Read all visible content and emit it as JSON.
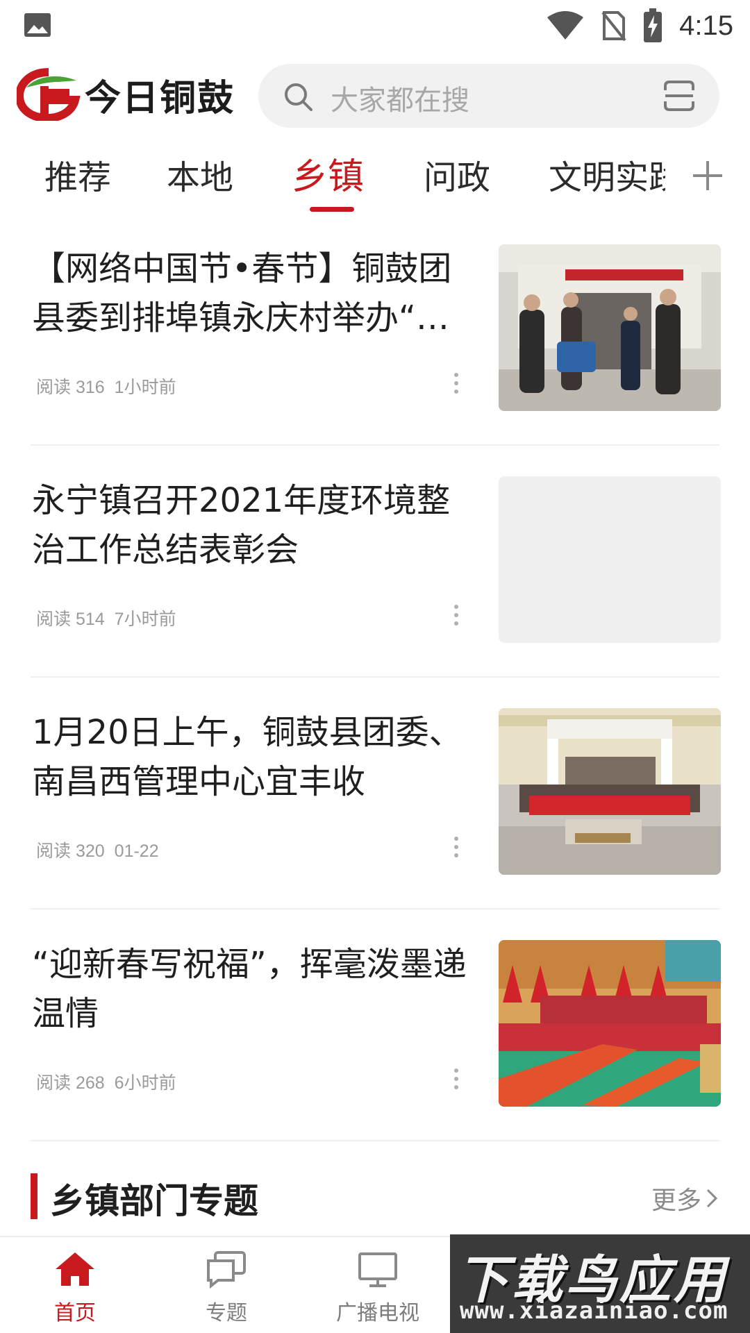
{
  "status_bar": {
    "time": "4:15",
    "icons": [
      "image-icon",
      "wifi-icon",
      "no-sim-icon",
      "battery-charging-icon"
    ]
  },
  "header": {
    "logo_text": "今日铜鼓",
    "search_placeholder": "大家都在搜",
    "brand_colors": {
      "red": "#c8191e",
      "green": "#4aa334"
    }
  },
  "tabs": [
    {
      "label": "推荐",
      "active": false
    },
    {
      "label": "本地",
      "active": false
    },
    {
      "label": "乡镇",
      "active": true
    },
    {
      "label": "问政",
      "active": false
    },
    {
      "label": "文明实践",
      "active": false
    }
  ],
  "news": [
    {
      "title": "【网络中国节•春节】铜鼓团县委到排埠镇永庆村举办“暖冬行动”",
      "reads_label": "阅读 316",
      "time": "1小时前",
      "thumb": "photo-people-donation"
    },
    {
      "title": "永宁镇召开2021年度环境整治工作总结表彰会",
      "reads_label": "阅读 514",
      "time": "7小时前",
      "thumb": "placeholder"
    },
    {
      "title": "1月20日上午，铜鼓县团委、南昌西管理中心宜丰收",
      "reads_label": "阅读 320",
      "time": "01-22",
      "thumb": "photo-group-banner"
    },
    {
      "title": "“迎新春写祝福”，挥毫泼墨递温情",
      "reads_label": "阅读 268",
      "time": "6小时前",
      "thumb": "photo-calligraphy-hall"
    }
  ],
  "section": {
    "title": "乡镇部门专题",
    "more_label": "更多"
  },
  "bottom_nav": [
    {
      "label": "首页",
      "icon": "home-icon",
      "active": true
    },
    {
      "label": "专题",
      "icon": "chat-icon",
      "active": false
    },
    {
      "label": "广播电视",
      "icon": "tv-icon",
      "active": false
    }
  ],
  "watermark": {
    "top": "下载鸟应用",
    "bottom": "www.xiazainiao.com"
  }
}
